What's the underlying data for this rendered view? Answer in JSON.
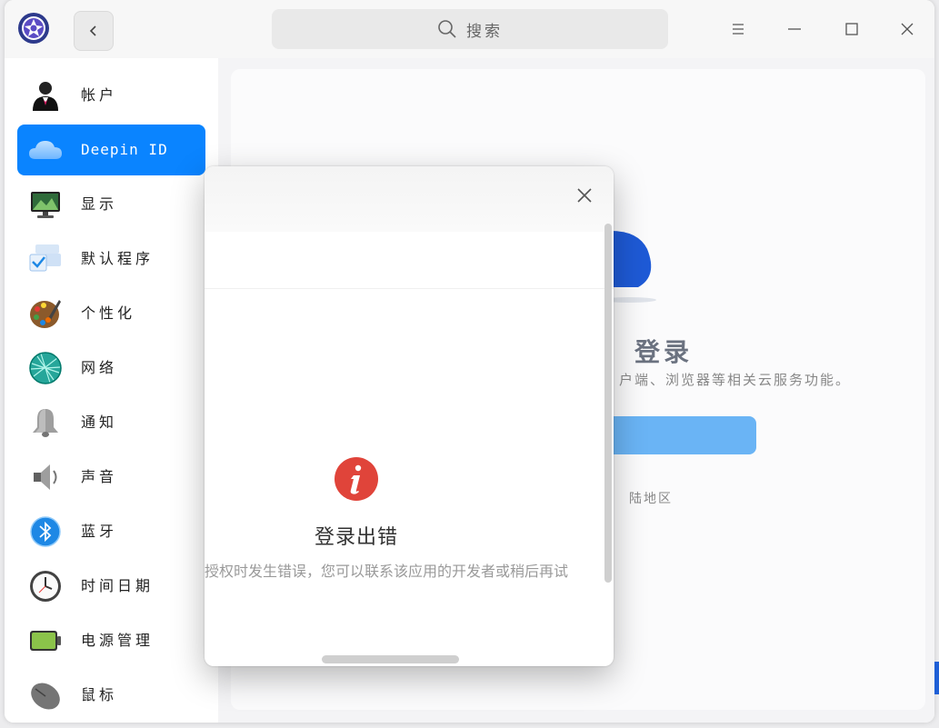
{
  "titlebar": {
    "search_placeholder": "搜索",
    "icons": {
      "logo": "settings-app-logo",
      "back": "chevron-left-icon",
      "search": "search-icon",
      "menu": "menu-icon",
      "minimize": "minimize-icon",
      "maximize": "maximize-icon",
      "close": "close-icon"
    }
  },
  "sidebar": {
    "items": [
      {
        "label": "帐户",
        "icon": "account-icon",
        "active": false
      },
      {
        "label": "Deepin ID",
        "icon": "cloud-icon",
        "active": true
      },
      {
        "label": "显示",
        "icon": "display-icon",
        "active": false
      },
      {
        "label": "默认程序",
        "icon": "default-apps-icon",
        "active": false
      },
      {
        "label": "个性化",
        "icon": "personalization-icon",
        "active": false
      },
      {
        "label": "网络",
        "icon": "network-icon",
        "active": false
      },
      {
        "label": "通知",
        "icon": "bell-icon",
        "active": false
      },
      {
        "label": "声音",
        "icon": "speaker-icon",
        "active": false
      },
      {
        "label": "蓝牙",
        "icon": "bluetooth-icon",
        "active": false
      },
      {
        "label": "时间日期",
        "icon": "clock-icon",
        "active": false
      },
      {
        "label": "电源管理",
        "icon": "battery-icon",
        "active": false
      },
      {
        "label": "鼠标",
        "icon": "mouse-icon",
        "active": false
      }
    ]
  },
  "background_page": {
    "title": "登录",
    "description": "户端、浏览器等相关云服务功能。",
    "region": "陆地区"
  },
  "dialog": {
    "error_title": "登录出错",
    "error_description": "授权时发生错误，您可以联系该应用的开发者或稍后再试",
    "colors": {
      "error_icon": "#e0443a"
    }
  },
  "colors": {
    "accent": "#0a84ff"
  }
}
